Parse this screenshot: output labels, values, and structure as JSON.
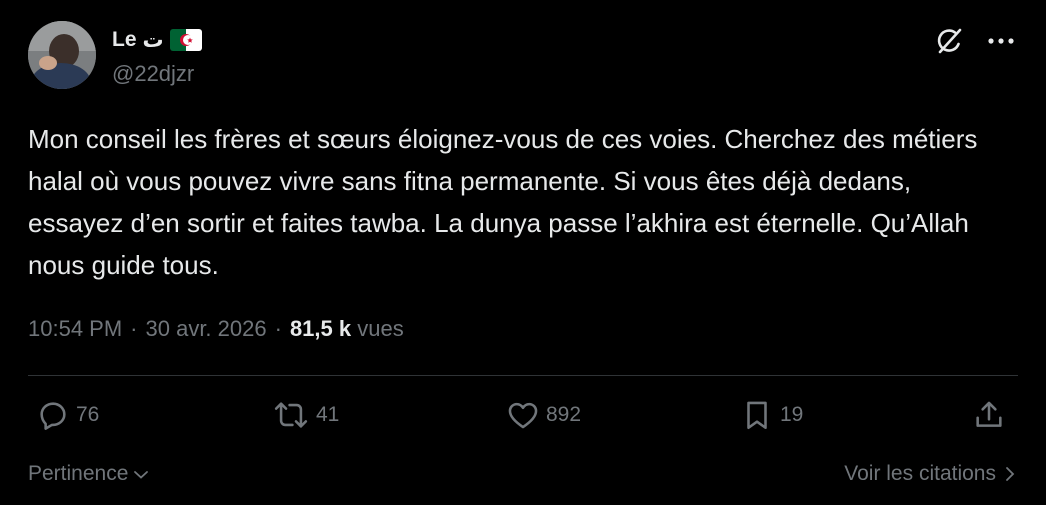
{
  "author": {
    "name": "Le",
    "name_arabic": "ت",
    "handle": "@22djzr",
    "flag": "algeria-flag"
  },
  "tweet": {
    "text": "Mon conseil les frères et sœurs éloignez-vous de ces voies. Cherchez des métiers halal où vous pouvez vivre sans fitna permanente. Si vous êtes déjà dedans, essayez d’en sortir et faites tawba. La dunya passe l’akhira est éternelle. Qu’Allah nous guide tous."
  },
  "meta": {
    "time": "10:54 PM",
    "separator": "·",
    "date": "30 avr. 2026",
    "views_count": "81,5 k",
    "views_label": "vues"
  },
  "actions": {
    "replies": "76",
    "reposts": "41",
    "likes": "892",
    "bookmarks": "19"
  },
  "footer": {
    "sort_label": "Pertinence",
    "quotes_label": "Voir les citations"
  },
  "colors": {
    "background": "#000000",
    "text": "#e7e9ea",
    "muted": "#71767b",
    "divider": "#2f3336"
  }
}
